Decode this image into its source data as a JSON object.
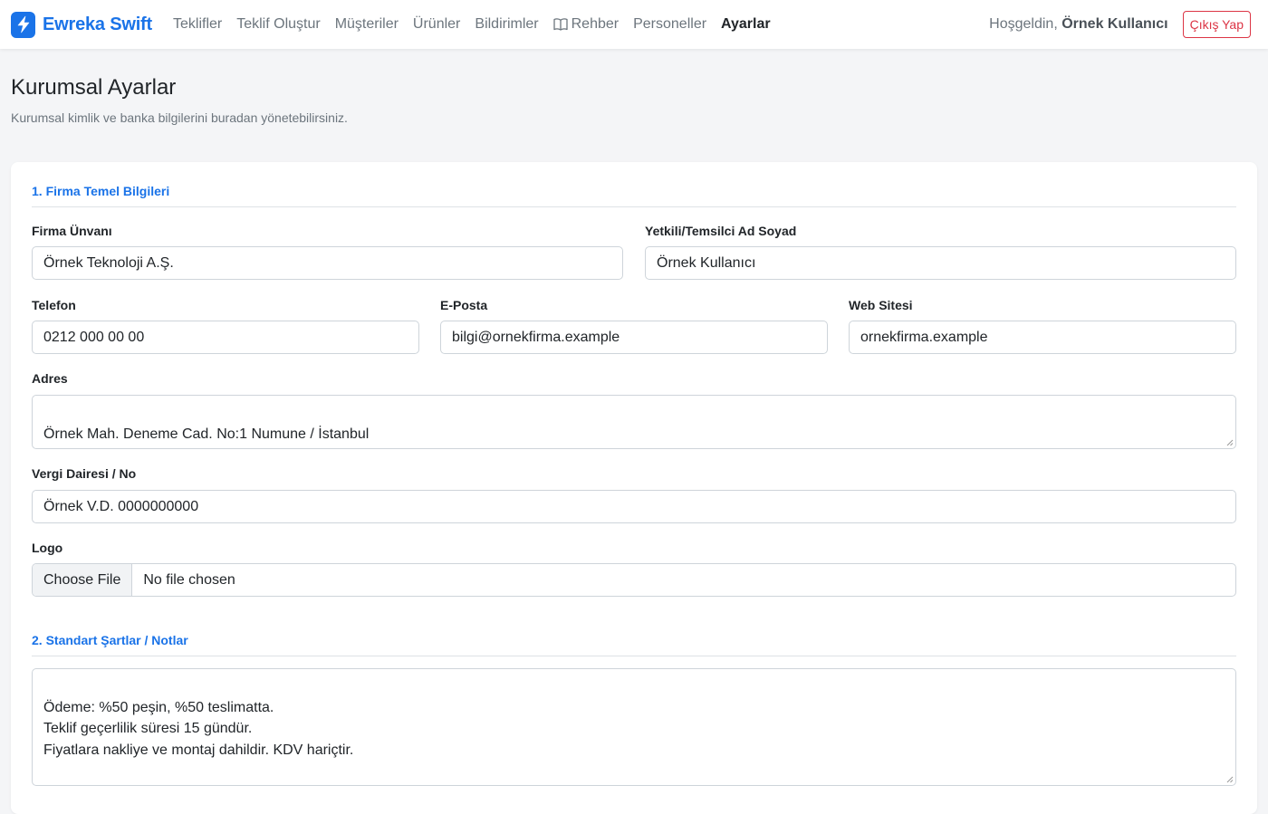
{
  "brand": {
    "name": "Ewreka Swift",
    "icon": "lightning-bolt-icon",
    "color": "#1a73e8"
  },
  "nav": {
    "items": [
      {
        "label": "Teklifler"
      },
      {
        "label": "Teklif Oluştur"
      },
      {
        "label": "Müşteriler"
      },
      {
        "label": "Ürünler"
      },
      {
        "label": "Bildirimler"
      },
      {
        "label": "Rehber",
        "icon": "book-icon"
      },
      {
        "label": "Personeller"
      },
      {
        "label": "Ayarlar",
        "active": true
      }
    ],
    "greeting_prefix": "Hoşgeldin,",
    "user_name": "Örnek Kullanıcı",
    "logout_label": "Çıkış Yap"
  },
  "page": {
    "title": "Kurumsal Ayarlar",
    "subtitle": "Kurumsal kimlik ve banka bilgilerini buradan yönetebilirsiniz."
  },
  "section1": {
    "title": "1. Firma Temel Bilgileri",
    "company_label": "Firma Ünvanı",
    "company_value": "Örnek Teknoloji A.Ş.",
    "rep_label": "Yetkili/Temsilci Ad Soyad",
    "rep_value": "Örnek Kullanıcı",
    "phone_label": "Telefon",
    "phone_value": "0212 000 00 00",
    "email_label": "E-Posta",
    "email_value": "bilgi@ornekfirma.example",
    "web_label": "Web Sitesi",
    "web_value": "ornekfirma.example",
    "address_label": "Adres",
    "address_value": "Örnek Mah. Deneme Cad. No:1 Numune / İstanbul",
    "tax_label": "Vergi Dairesi / No",
    "tax_value": "Örnek V.D. 0000000000",
    "logo_label": "Logo",
    "file_button": "Choose File",
    "file_status": "No file chosen"
  },
  "section2": {
    "title": "2. Standart Şartlar / Notlar",
    "notes_value": "Ödeme: %50 peşin, %50 teslimatta.\nTeklif geçerlilik süresi 15 gündür.\nFiyatlara nakliye ve montaj dahildir. KDV hariçtir."
  }
}
